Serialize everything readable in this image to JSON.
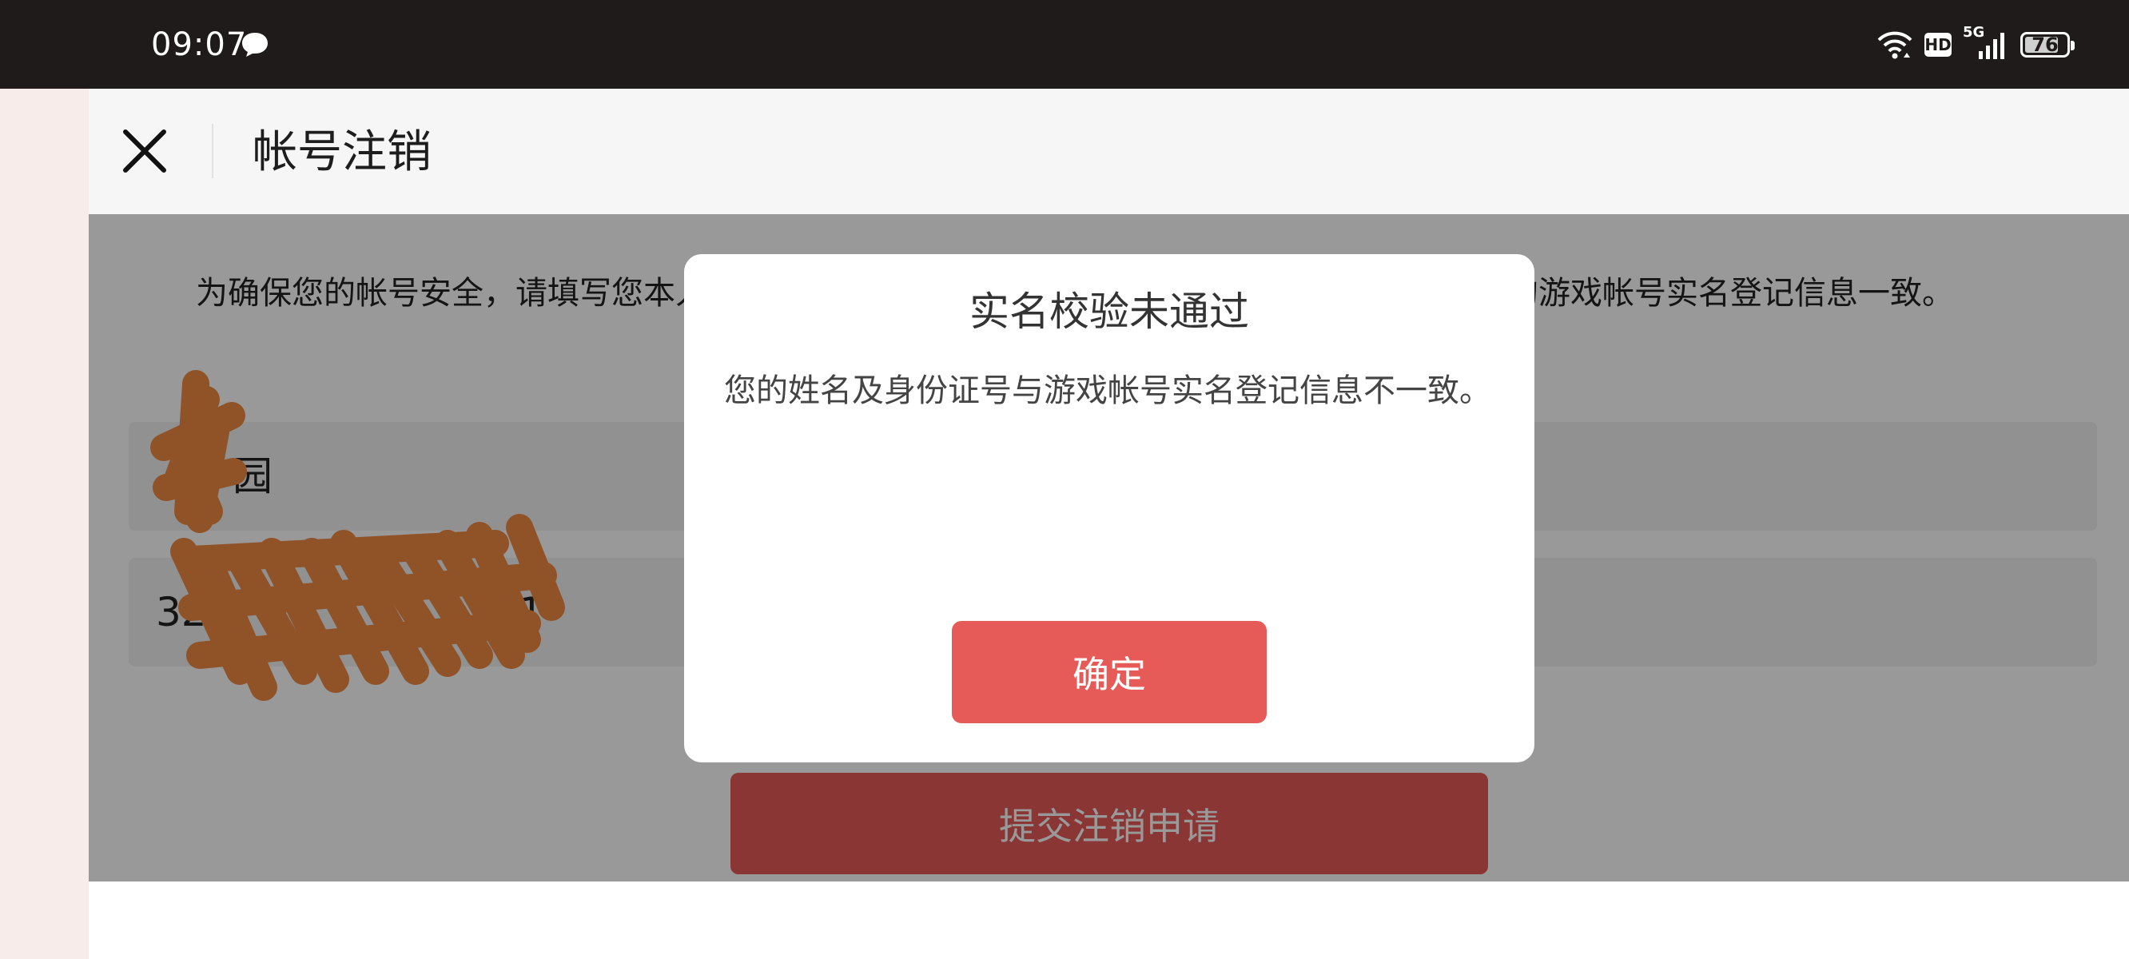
{
  "status_bar": {
    "time": "09:07",
    "hd_label": "HD",
    "network_label": "5G",
    "battery_level": "76",
    "icons": [
      "chat-bubble-icon",
      "wifi-icon",
      "hd-icon",
      "signal-icon",
      "battery-icon"
    ]
  },
  "header": {
    "close_icon": "close-icon",
    "title": "帐号注销"
  },
  "main": {
    "description": "为确保您的帐号安全，请填写您本人的真实姓名及身份证号，您填写的姓名及身份证号应与您的游戏帐号实名登记信息一致。",
    "name_field_value": "园",
    "id_field_prefix": "32",
    "id_field_suffix": "1",
    "submit_label": "提交注销申请"
  },
  "dialog": {
    "title": "实名校验未通过",
    "message": "您的姓名及身份证号与游戏帐号实名登记信息不一致。",
    "confirm_label": "确定"
  },
  "colors": {
    "status_bar_bg": "#1f1b1a",
    "accent_red": "#e65b57",
    "redaction_orange": "#f08a43",
    "overlay": "rgba(0,0,0,0.4)"
  }
}
